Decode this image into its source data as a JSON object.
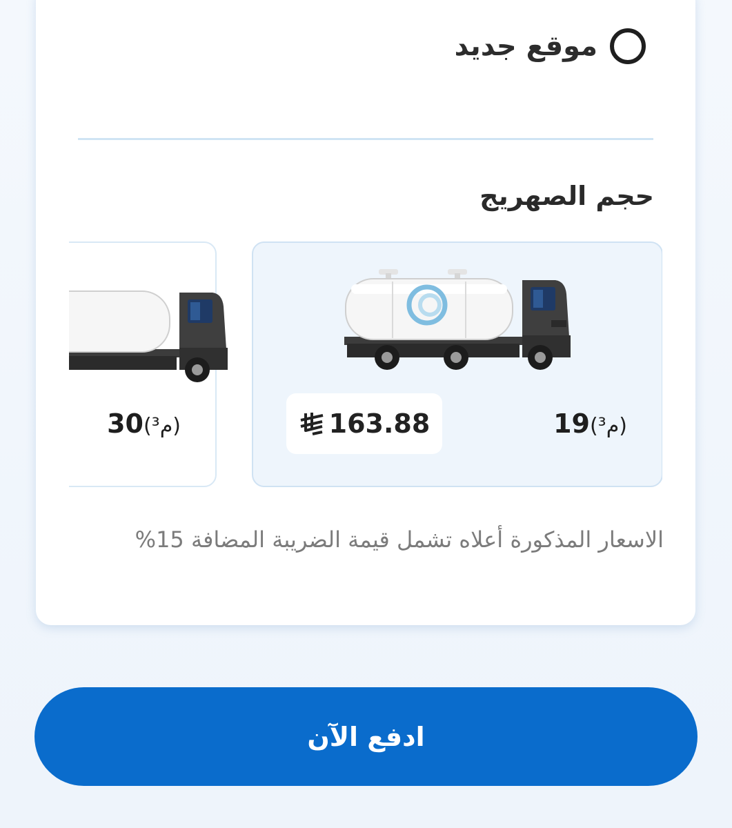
{
  "location_option": {
    "label": "موقع جديد",
    "selected": false
  },
  "tanker_section": {
    "title": "حجم الصهريج",
    "options": [
      {
        "size_number": "19",
        "size_unit": "(م³)",
        "price": "163.88",
        "currency_icon": "saudi-riyal-icon",
        "selected": true
      },
      {
        "size_number": "30",
        "size_unit": "(م³)",
        "selected": false
      }
    ]
  },
  "vat_note": "الاسعار المذكورة أعلاه تشمل قيمة الضريبة المضافة 15%",
  "pay_button": {
    "label": "ادفع الآن"
  },
  "colors": {
    "primary": "#0a6ccc",
    "selected_card_bg": "#eef5fc",
    "divider": "#cfe4f4",
    "note_text": "#7b7b7b"
  }
}
